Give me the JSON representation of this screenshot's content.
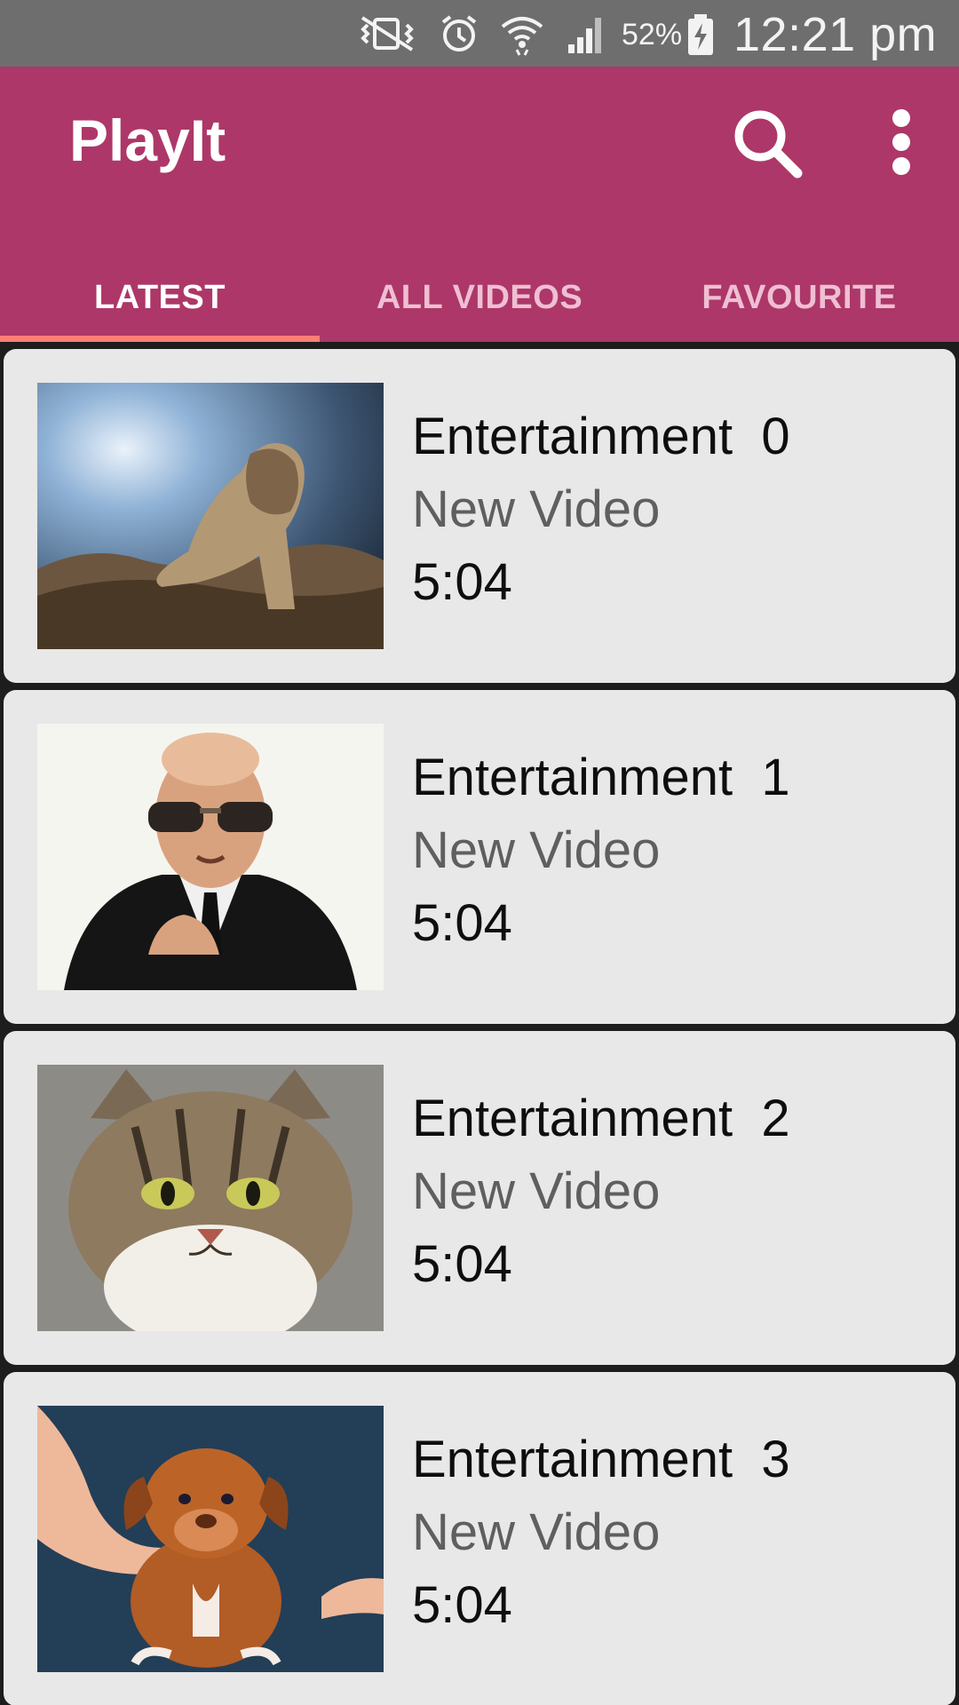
{
  "status_bar": {
    "battery_percent": "52%",
    "time": "12:21 pm",
    "icons": [
      "vibrate-mute-icon",
      "alarm-icon",
      "wifi-icon",
      "signal-icon",
      "battery-charging-icon"
    ]
  },
  "app_bar": {
    "title": "PlayIt",
    "actions": [
      "search-icon",
      "more-vert-icon"
    ],
    "color": "#ad3768"
  },
  "tabs": [
    {
      "label": "LATEST",
      "active": true
    },
    {
      "label": "ALL VIDEOS",
      "active": false
    },
    {
      "label": "FAVOURITE",
      "active": false
    }
  ],
  "tab_indicator_color": "#ff7e74",
  "videos": [
    {
      "title": "Entertainment  0",
      "subtitle": "New Video",
      "duration": "5:04",
      "thumbnail": "lion"
    },
    {
      "title": "Entertainment  1",
      "subtitle": "New Video",
      "duration": "5:04",
      "thumbnail": "man-in-suit"
    },
    {
      "title": "Entertainment  2",
      "subtitle": "New Video",
      "duration": "5:04",
      "thumbnail": "cat"
    },
    {
      "title": "Entertainment  3",
      "subtitle": "New Video",
      "duration": "5:04",
      "thumbnail": "puppy"
    }
  ]
}
